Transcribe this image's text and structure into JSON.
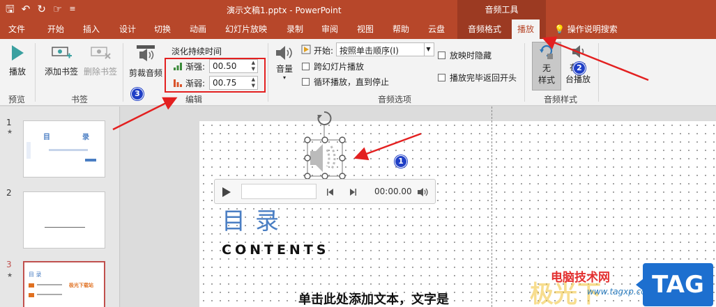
{
  "titlebar": {
    "doc_title": "演示文稿1.pptx  -  PowerPoint",
    "context_group": "音频工具",
    "colors": {
      "bar": "#b7472a",
      "context": "#9c3a22"
    }
  },
  "tabs": [
    "文件",
    "开始",
    "插入",
    "设计",
    "切换",
    "动画",
    "幻灯片放映",
    "录制",
    "审阅",
    "视图",
    "帮助",
    "云盘",
    "音频格式",
    "播放"
  ],
  "tell_me": "操作说明搜索",
  "ribbon": {
    "preview": {
      "play_label": "播放",
      "group": "预览"
    },
    "bookmarks": {
      "add_label": "添加书签",
      "remove_label": "删除书签",
      "group": "书签"
    },
    "editing": {
      "trim_label": "剪裁音频",
      "fade_title": "淡化持续时间",
      "fade_in_label": "渐强:",
      "fade_in_value": "00.50",
      "fade_out_label": "渐弱:",
      "fade_out_value": "00.75",
      "group": "编辑"
    },
    "audio_options": {
      "volume_label": "音量",
      "start_label": "开始:",
      "start_value": "按照单击顺序(I)",
      "play_across": "跨幻灯片播放",
      "loop": "循环播放，直到停止",
      "hide": "放映时隐藏",
      "rewind": "播放完毕返回开头",
      "group": "音频选项"
    },
    "audio_styles": {
      "no_style_1": "无",
      "no_style_2": "样式",
      "bg_play_1": "在后",
      "bg_play_2": "台播放",
      "group": "音频样式"
    }
  },
  "slides": [
    {
      "num": "1",
      "star": "★"
    },
    {
      "num": "2",
      "star": ""
    },
    {
      "num": "3",
      "star": "★"
    }
  ],
  "thumb1": {
    "t1": "目",
    "t2": "录"
  },
  "thumb3": {
    "t1": "目 录",
    "t2": "极光下载站"
  },
  "slide": {
    "title": "目录",
    "subtitle": "CONTENTS",
    "body": "单击此处添加文本，文字是",
    "player_time": "00:00.00"
  },
  "badges": [
    "1",
    "2",
    "3"
  ],
  "watermark": {
    "site": "电脑技术网",
    "url": "www.tagxp.com",
    "tag": "TAG",
    "bg": "极光下"
  }
}
